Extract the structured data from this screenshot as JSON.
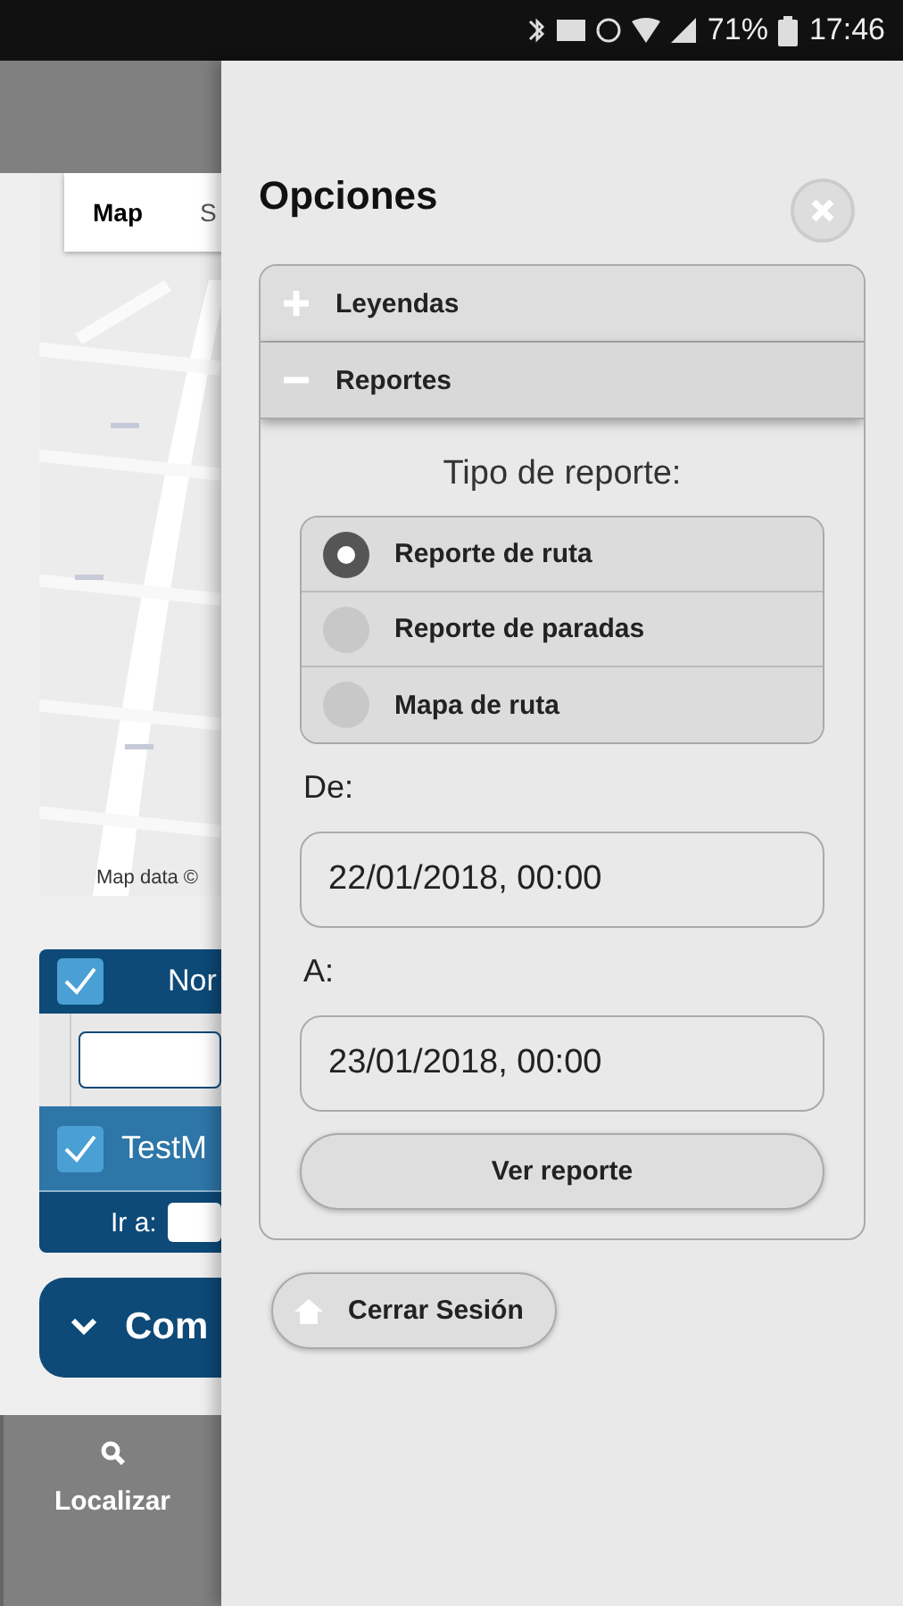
{
  "status_bar": {
    "battery": "71%",
    "time": "17:46"
  },
  "background": {
    "map": {
      "kind": "picture",
      "map_types": [
        {
          "label": "Map",
          "selected": true
        },
        {
          "label": "S",
          "selected": false
        }
      ],
      "attribution": "Map data ©"
    },
    "table": {
      "header_checked": true,
      "header": "Nor",
      "rows": [
        {
          "checked": true,
          "name": "TestM"
        }
      ],
      "goto_label": "Ir a:"
    },
    "collapse_button": "Com",
    "nav": [
      {
        "label": "Localizar"
      }
    ]
  },
  "panel": {
    "title": "Opciones",
    "sections": [
      {
        "label": "Leyendas",
        "expanded": false
      },
      {
        "label": "Reportes",
        "expanded": true
      }
    ],
    "report_type_label": "Tipo de reporte:",
    "report_types": [
      {
        "label": "Reporte de ruta",
        "selected": true
      },
      {
        "label": "Reporte de paradas",
        "selected": false
      },
      {
        "label": "Mapa de ruta",
        "selected": false
      }
    ],
    "from_label": "De:",
    "from_value": "22/01/2018, 00:00",
    "to_label": "A:",
    "to_value": "23/01/2018, 00:00",
    "submit": "Ver reporte",
    "logout": "Cerrar Sesión"
  }
}
